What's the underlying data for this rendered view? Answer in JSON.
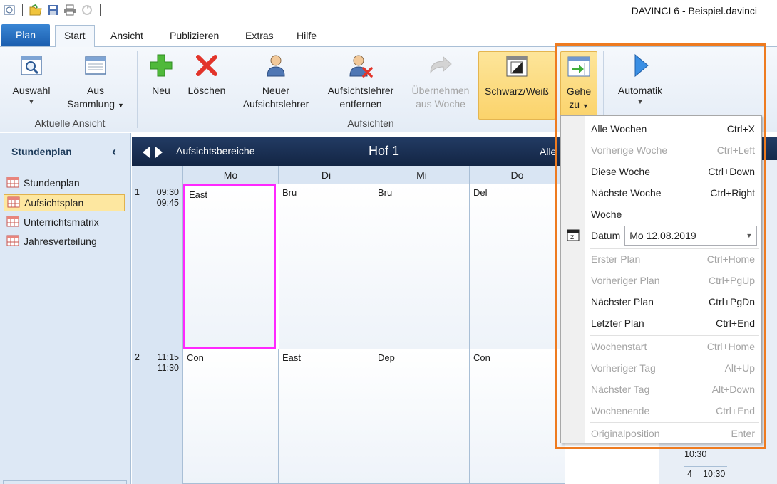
{
  "app": {
    "title": "DAVINCI 6 - Beispiel.davinci"
  },
  "tabs": {
    "plan": "Plan",
    "start": "Start",
    "ansicht": "Ansicht",
    "publizieren": "Publizieren",
    "extras": "Extras",
    "hilfe": "Hilfe"
  },
  "ribbon": {
    "auswahl": "Auswahl",
    "aus_sammlung_1": "Aus",
    "aus_sammlung_2": "Sammlung",
    "group_ansicht": "Aktuelle Ansicht",
    "neu": "Neu",
    "loeschen": "Löschen",
    "neuer_1": "Neuer",
    "neuer_2": "Aufsichtslehrer",
    "entfernen_1": "Aufsichtslehrer",
    "entfernen_2": "entfernen",
    "uebernehmen_1": "Übernehmen",
    "uebernehmen_2": "aus Woche",
    "group_aufsichten": "Aufsichten",
    "schwarzweiss": "Schwarz/Weiß",
    "gehe_1": "Gehe",
    "gehe_2": "zu",
    "automatik": "Automatik"
  },
  "sidebar": {
    "title": "Stundenplan",
    "collapse": "‹",
    "items": [
      {
        "label": "Stundenplan"
      },
      {
        "label": "Aufsichtsplan"
      },
      {
        "label": "Unterrichtsmatrix"
      },
      {
        "label": "Jahresverteilung"
      }
    ]
  },
  "schedule": {
    "area": "Aufsichtsbereiche",
    "title": "Hof 1",
    "right_label": "Alle",
    "days": [
      "Mo",
      "Di",
      "Mi",
      "Do"
    ],
    "slots": [
      {
        "num": "1",
        "start": "09:30",
        "end": "09:45",
        "cells": [
          "East",
          "Bru",
          "Bru",
          "Del"
        ]
      },
      {
        "num": "2",
        "start": "11:15",
        "end": "11:30",
        "cells": [
          "Con",
          "East",
          "Dep",
          "Con"
        ]
      }
    ],
    "right_slot_3_end": "10:30",
    "right_slot_4_num": "4",
    "right_slot_4_start": "10:30"
  },
  "menu": {
    "items": [
      {
        "label": "Alle Wochen",
        "shortcut": "Ctrl+X",
        "enabled": true
      },
      {
        "label": "Vorherige Woche",
        "shortcut": "Ctrl+Left",
        "enabled": false
      },
      {
        "label": "Diese Woche",
        "shortcut": "Ctrl+Down",
        "enabled": true
      },
      {
        "label": "Nächste Woche",
        "shortcut": "Ctrl+Right",
        "enabled": true
      },
      {
        "label": "Woche",
        "shortcut": "",
        "enabled": true
      }
    ],
    "date_label": "Datum",
    "date_value": "Mo 12.08.2019",
    "items2": [
      {
        "label": "Erster Plan",
        "shortcut": "Ctrl+Home",
        "enabled": false
      },
      {
        "label": "Vorheriger Plan",
        "shortcut": "Ctrl+PgUp",
        "enabled": false
      },
      {
        "label": "Nächster Plan",
        "shortcut": "Ctrl+PgDn",
        "enabled": true
      },
      {
        "label": "Letzter Plan",
        "shortcut": "Ctrl+End",
        "enabled": true
      }
    ],
    "items3": [
      {
        "label": "Wochenstart",
        "shortcut": "Ctrl+Home",
        "enabled": false
      },
      {
        "label": "Vorheriger Tag",
        "shortcut": "Alt+Up",
        "enabled": false
      },
      {
        "label": "Nächster Tag",
        "shortcut": "Alt+Down",
        "enabled": false
      },
      {
        "label": "Wochenende",
        "shortcut": "Ctrl+End",
        "enabled": false
      }
    ],
    "items4": [
      {
        "label": "Originalposition",
        "shortcut": "Enter",
        "enabled": false
      }
    ]
  },
  "colors": {
    "highlight_frame": "#ee7b20",
    "selected_cell": "#ff28ff",
    "plan_tab": "#1c5fb0",
    "header_bar": "#132544"
  }
}
